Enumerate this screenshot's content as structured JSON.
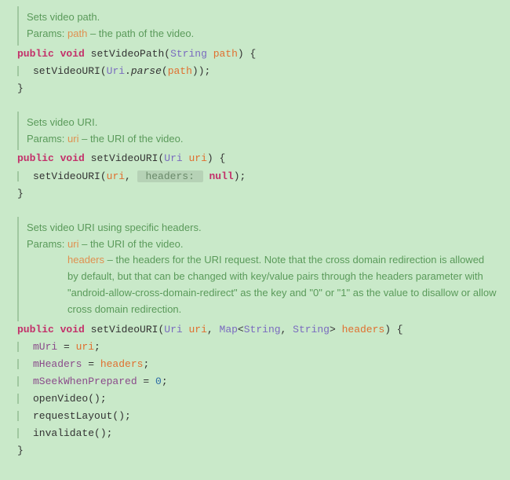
{
  "methods": [
    {
      "doc": {
        "summary": "Sets video path.",
        "params_label": "Params:",
        "params": [
          {
            "name": "path",
            "desc": " – the path of the video."
          }
        ]
      },
      "sig": {
        "mods": "public void",
        "name": "setVideoPath",
        "p1_type": "String",
        "p1_name": "path",
        "open": "(",
        "close": ") {"
      },
      "body": {
        "call": "setVideoURI",
        "lp": "(",
        "inner_type": "Uri",
        "dot": ".",
        "inner_call": "parse",
        "ilp": "(",
        "inner_arg": "path",
        "irp": "));"
      },
      "end": "}"
    },
    {
      "doc": {
        "summary": "Sets video URI.",
        "params_label": "Params:",
        "params": [
          {
            "name": "uri",
            "desc": " – the URI of the video."
          }
        ]
      },
      "sig": {
        "mods": "public void",
        "name": "setVideoURI",
        "p1_type": "Uri",
        "p1_name": "uri",
        "open": "(",
        "close": ") {"
      },
      "body": {
        "call": "setVideoURI",
        "lp": "(",
        "arg1": "uri",
        "comma": ", ",
        "hint": " headers: ",
        "nul": "null",
        "rp": ");"
      },
      "end": "}"
    },
    {
      "doc": {
        "summary": "Sets video URI using specific headers.",
        "params_label": "Params:",
        "params": [
          {
            "name": "uri",
            "desc": " – the URI of the video."
          },
          {
            "name": "headers",
            "desc": " – the headers for the URI request. Note that the cross domain redirection is allowed by default, but that can be changed with key/value pairs through the headers parameter with \"android-allow-cross-domain-redirect\" as the key and \"0\" or \"1\" as the value to disallow or allow cross domain redirection."
          }
        ]
      },
      "sig": {
        "mods": "public void",
        "name": "setVideoURI",
        "open": "(",
        "p1_type": "Uri",
        "p1_name": "uri",
        "comma": ", ",
        "p2_type": "Map",
        "lt": "<",
        "g1": "String",
        "gc": ", ",
        "g2": "String",
        "gt": ">",
        "p2_name": "headers",
        "close": ") {"
      },
      "body_lines": {
        "l1_field": "mUri",
        "l1_eq": " = ",
        "l1_val": "uri",
        "l1_semi": ";",
        "l2_field": "mHeaders",
        "l2_eq": " = ",
        "l2_val": "headers",
        "l2_semi": ";",
        "l3_field": "mSeekWhenPrepared",
        "l3_eq": " = ",
        "l3_val": "0",
        "l3_semi": ";",
        "l4": "openVideo();",
        "l5": "requestLayout();",
        "l6": "invalidate();"
      },
      "end": "}"
    }
  ]
}
